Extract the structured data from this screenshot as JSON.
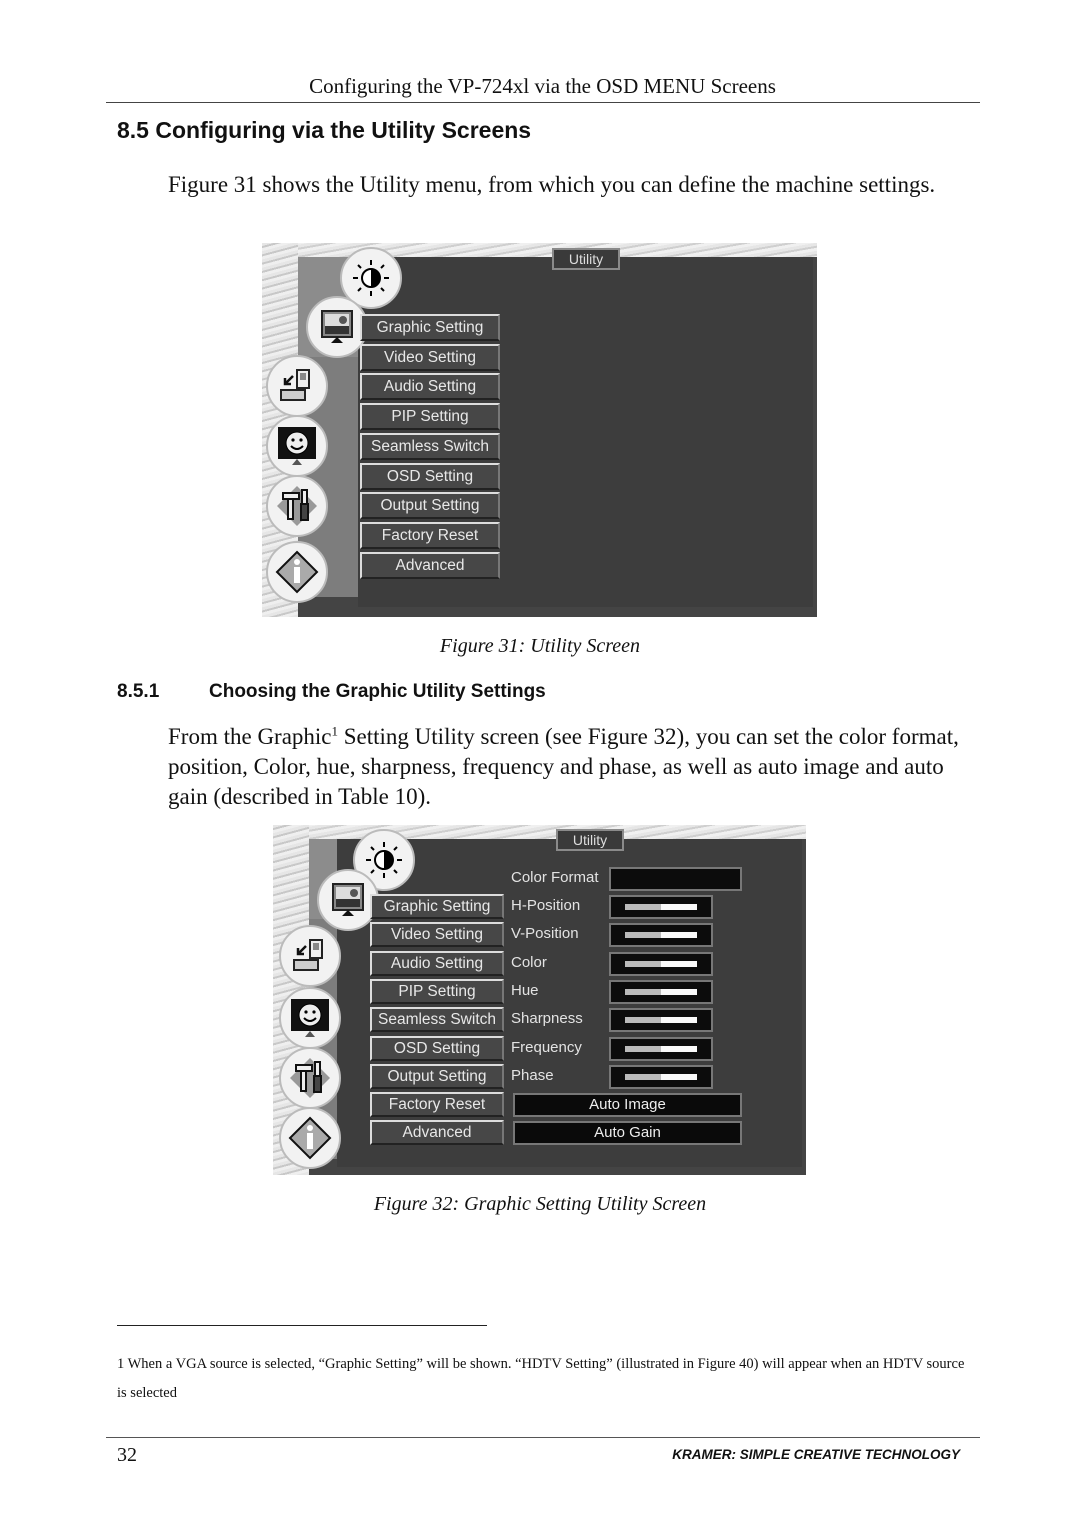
{
  "running_head": "Configuring the VP-724xl via the OSD MENU Screens",
  "section": {
    "heading": "8.5 Configuring via the Utility Screens",
    "intro": "Figure 31 shows the Utility menu, from which you can define the machine settings."
  },
  "figure31": {
    "title": "Utility",
    "menu_items": [
      "Graphic Setting",
      "Video Setting",
      "Audio Setting",
      "PIP Setting",
      "Seamless Switch",
      "OSD Setting",
      "Output Setting",
      "Factory Reset",
      "Advanced"
    ],
    "side_icons": [
      "brightness-contrast-icon",
      "picture-monitor-icon",
      "input-device-icon",
      "screen-adjust-smiley-icon",
      "tools-icon",
      "info-icon"
    ],
    "caption": "Figure 31: Utility Screen"
  },
  "subsection": {
    "number": "8.5.1",
    "heading": "Choosing the Graphic Utility Settings",
    "para_before_sup": "From the Graphic",
    "sup": "1",
    "para_after_sup": " Setting Utility screen (see Figure 32), you can set the color format, position, Color, hue, sharpness, frequency and phase, as well as auto image and auto gain (described in Table 10)."
  },
  "figure32": {
    "title": "Utility",
    "menu_items": [
      "Graphic Setting",
      "Video Setting",
      "Audio Setting",
      "PIP Setting",
      "Seamless Switch",
      "OSD Setting",
      "Output Setting",
      "Factory Reset",
      "Advanced"
    ],
    "color_format_label": "Color Format",
    "color_format_value": "",
    "sliders": [
      {
        "label": "H-Position",
        "value_pct": 50
      },
      {
        "label": "V-Position",
        "value_pct": 50
      },
      {
        "label": "Color",
        "value_pct": 50
      },
      {
        "label": "Hue",
        "value_pct": 50
      },
      {
        "label": "Sharpness",
        "value_pct": 50
      },
      {
        "label": "Frequency",
        "value_pct": 50
      },
      {
        "label": "Phase",
        "value_pct": 50
      }
    ],
    "auto_image_label": "Auto Image",
    "auto_gain_label": "Auto Gain",
    "caption": "Figure 32: Graphic Setting Utility Screen"
  },
  "footnote": "1 When a VGA source is selected, “Graphic Setting” will be shown. “HDTV Setting” (illustrated in Figure 40) will appear when an HDTV source is selected",
  "footer": {
    "page_number": "32",
    "brand": "KRAMER:  SIMPLE CREATIVE TECHNOLOGY"
  }
}
